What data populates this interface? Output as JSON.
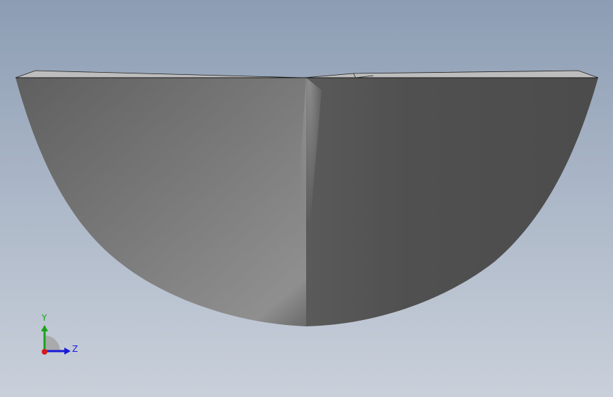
{
  "viewport": {
    "background_top": "#8c9db3",
    "background_bottom": "#c9d0da"
  },
  "model": {
    "shape": "half-cone",
    "face_light": "#8a8a8a",
    "face_dark": "#4e4e4e",
    "top_edge": "#c8c8c8"
  },
  "triad": {
    "y_label": "Y",
    "z_label": "Z",
    "y_color": "#1aa31a",
    "z_color": "#1a1ad6",
    "x_color": "#d41a1a"
  }
}
